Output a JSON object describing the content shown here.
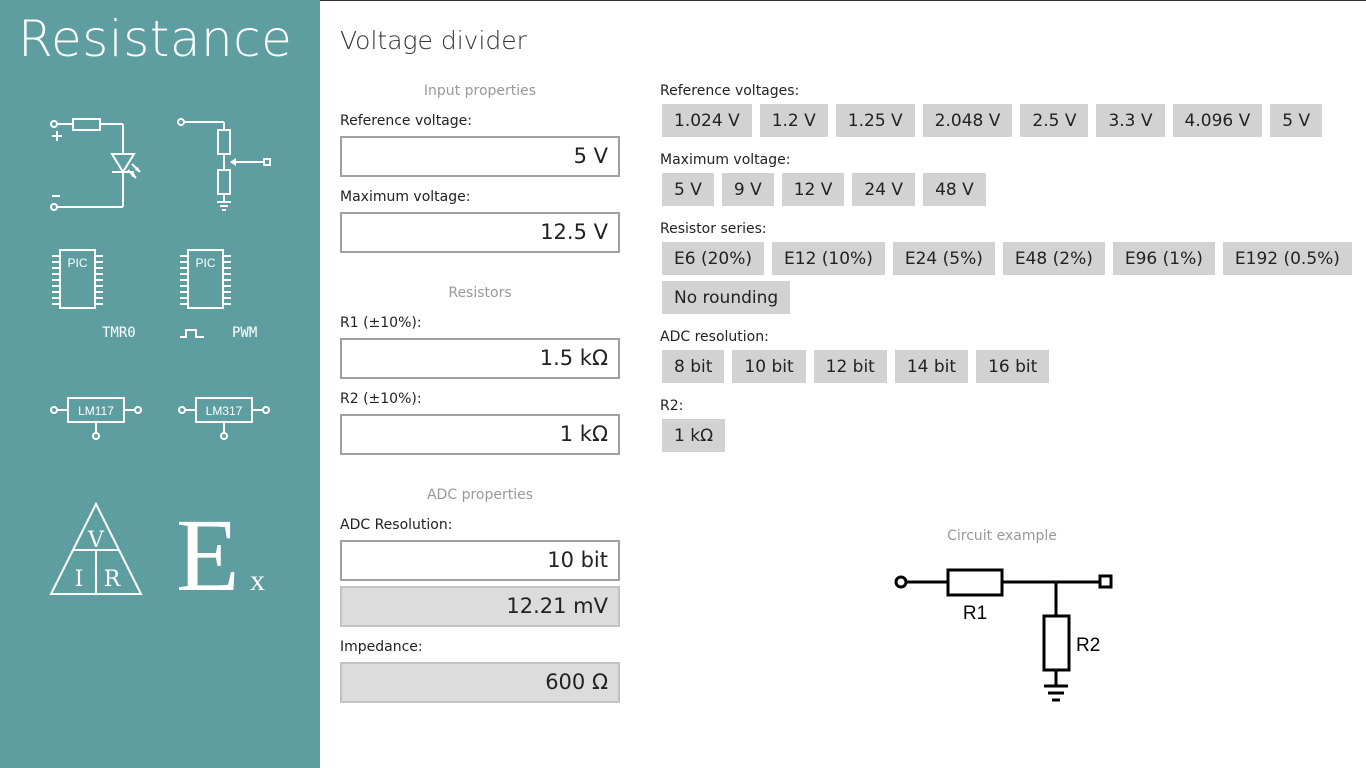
{
  "app": {
    "title": "Resistance"
  },
  "sidebar": {
    "items": [
      {
        "name": "led-resistor",
        "label": ""
      },
      {
        "name": "potentiometer",
        "label": ""
      },
      {
        "name": "pic-timer",
        "label": "TMR0"
      },
      {
        "name": "pic-pwm",
        "label": "PWM"
      },
      {
        "name": "lm117",
        "label": "LM117"
      },
      {
        "name": "lm317",
        "label": "LM317"
      },
      {
        "name": "ohms-law",
        "label": ""
      },
      {
        "name": "e-series",
        "label": ""
      }
    ],
    "chip_text": "PIC",
    "ohm_letters": {
      "v": "V",
      "i": "I",
      "r": "R"
    },
    "e_letter": "E",
    "e_sub": "x"
  },
  "page": {
    "title": "Voltage divider"
  },
  "input_properties": {
    "heading": "Input properties",
    "reference_label": "Reference voltage:",
    "reference_value": "5 V",
    "maximum_label": "Maximum voltage:",
    "maximum_value": "12.5 V"
  },
  "resistors": {
    "heading": "Resistors",
    "r1_label": "R1 (±10%):",
    "r1_value": "1.5 kΩ",
    "r2_label": "R2 (±10%):",
    "r2_value": "1 kΩ"
  },
  "adc_properties": {
    "heading": "ADC properties",
    "resolution_label": "ADC Resolution:",
    "resolution_value": "10 bit",
    "step_value": "12.21 mV",
    "impedance_label": "Impedance:",
    "impedance_value": "600 Ω"
  },
  "presets": {
    "reference_label": "Reference voltages:",
    "reference": [
      "1.024 V",
      "1.2 V",
      "1.25 V",
      "2.048 V",
      "2.5 V",
      "3.3 V",
      "4.096 V",
      "5 V"
    ],
    "maximum_label": "Maximum voltage:",
    "maximum": [
      "5 V",
      "9 V",
      "12 V",
      "24 V",
      "48 V"
    ],
    "series_label": "Resistor series:",
    "series": [
      "E6 (20%)",
      "E12 (10%)",
      "E24 (5%)",
      "E48 (2%)",
      "E96 (1%)",
      "E192 (0.5%)"
    ],
    "no_rounding": "No rounding",
    "adc_label": "ADC resolution:",
    "adc": [
      "8 bit",
      "10 bit",
      "12 bit",
      "14 bit",
      "16 bit"
    ],
    "r2_label": "R2:",
    "r2": [
      "1 kΩ"
    ]
  },
  "circuit": {
    "heading": "Circuit example",
    "r1": "R1",
    "r2": "R2"
  }
}
